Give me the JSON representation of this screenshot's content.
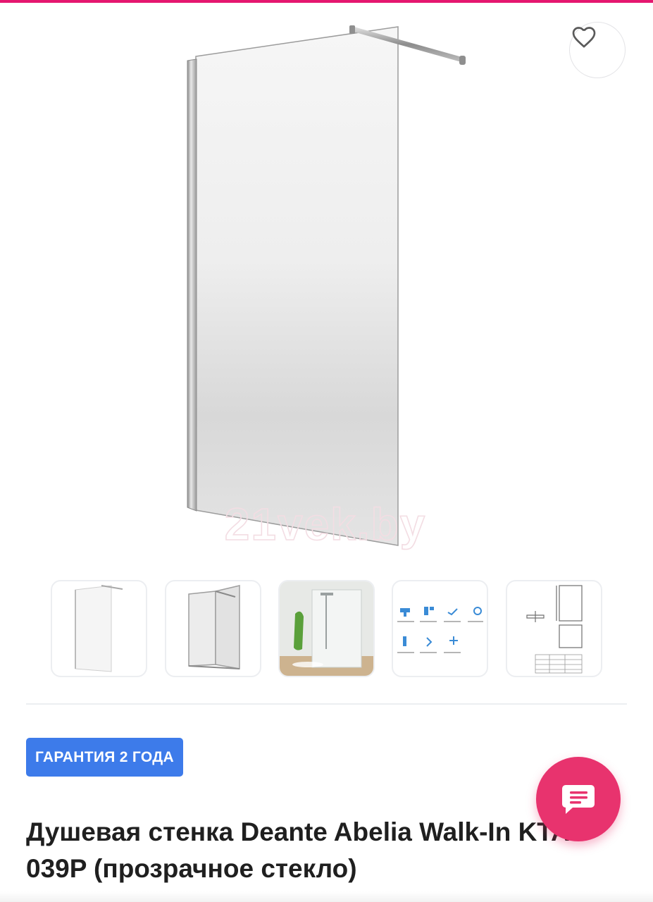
{
  "top_bar": {
    "accent_color": "#e5176f"
  },
  "product_image": {
    "watermark": "21vek.by",
    "favorite_icon": "heart-outline-icon"
  },
  "thumbnails": [
    {
      "kind": "glass-panel-front"
    },
    {
      "kind": "glass-panel-perspective"
    },
    {
      "kind": "bathroom-interior"
    },
    {
      "kind": "feature-icons"
    },
    {
      "kind": "technical-drawing"
    }
  ],
  "badge": {
    "label": "ГАРАНТИЯ 2 ГОДА",
    "color": "#3d7bea"
  },
  "product": {
    "title": "Душевая стенка Deante Abelia Walk-In KTA 039P (прозрачное стекло)"
  },
  "chat": {
    "icon": "chat-bubble-icon",
    "color": "#e8336e"
  }
}
